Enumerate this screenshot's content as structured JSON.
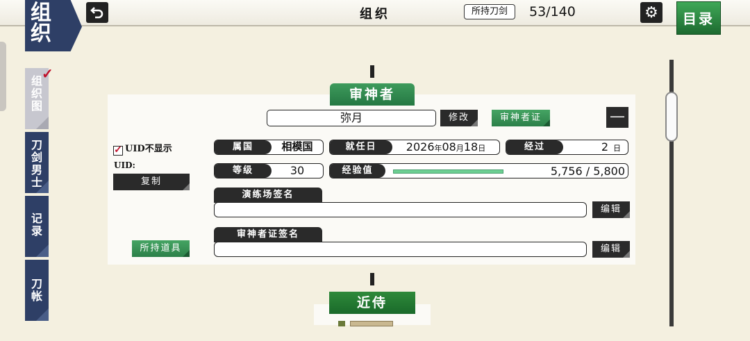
{
  "header": {
    "section": [
      "组",
      "织"
    ],
    "title": "组织",
    "owned_label": "所持刀剑",
    "owned_count": "53/140",
    "menu_label": "目录"
  },
  "sidebar": {
    "items": [
      {
        "label": "组\n织\n图",
        "active": true
      },
      {
        "label": "刀\n剑\n男\n士",
        "active": false
      },
      {
        "label": "记\n录",
        "active": false
      },
      {
        "label": "刀\n帐",
        "active": false
      }
    ],
    "check_mark": "✓"
  },
  "saniwa": {
    "header": "审神者",
    "name": "弥月",
    "edit_name_label": "修改",
    "card_label": "审神者证",
    "collapse_label": "—",
    "uid_toggle_label": "UID不显示",
    "uid_checked_mark": "✓",
    "uid_label": "UID:",
    "copy_label": "复制",
    "items_label": "所持道具",
    "country": {
      "label": "属国",
      "value": "相模国"
    },
    "appointed": {
      "label": "就任日",
      "year": "2026",
      "year_unit": "年",
      "month": "08",
      "month_unit": "月",
      "day": "18",
      "day_unit": "日"
    },
    "elapsed": {
      "label": "经过",
      "value": "2",
      "unit": "日"
    },
    "level": {
      "label": "等级",
      "value": "30"
    },
    "exp": {
      "label": "经验值",
      "value": "5,756 / 5,800",
      "current": 5756,
      "max": 5800
    },
    "training_sig": {
      "label": "演练场签名",
      "value": "",
      "edit_label": "编辑"
    },
    "card_sig": {
      "label": "审神者证签名",
      "value": "",
      "edit_label": "编辑"
    }
  },
  "retainer": {
    "header": "近侍"
  },
  "colors": {
    "accent_green": "#2e8a4f",
    "navy": "#2e3f66",
    "dark": "#2a2a2a",
    "check_red": "#c0102a"
  }
}
